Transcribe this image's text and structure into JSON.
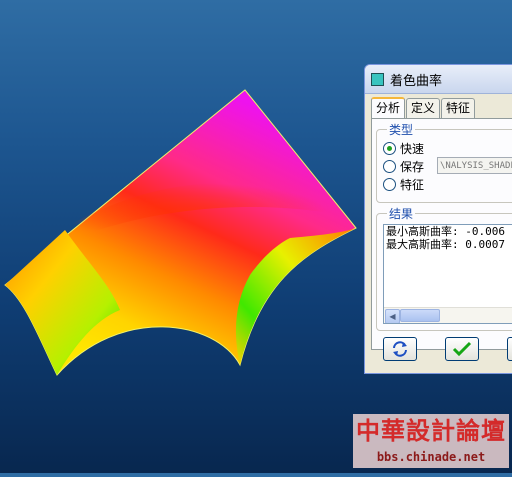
{
  "dialog": {
    "title": "着色曲率",
    "tabs": [
      "分析",
      "定义",
      "特征"
    ],
    "type_group": {
      "title": "类型",
      "options": [
        "快速",
        "保存",
        "特征"
      ],
      "selected": "快速",
      "save_name": "\\NALYSIS_SHADE"
    },
    "results_group": {
      "title": "结果",
      "lines": [
        "最小高斯曲率: -0.006",
        "最大高斯曲率: 0.0007"
      ]
    },
    "buttons": {
      "repeat_icon": "refresh-icon",
      "ok_icon": "checkmark-icon"
    }
  },
  "watermark": {
    "title": "中華設計論壇",
    "url": "bbs.chinade.net"
  },
  "colors": {
    "background_top": "#2f6da4",
    "background_bottom": "#08274f",
    "surface_magenta": "#ee12ee",
    "surface_red": "#ff1a1a",
    "surface_yellow": "#ffe500",
    "surface_green": "#25e400"
  }
}
